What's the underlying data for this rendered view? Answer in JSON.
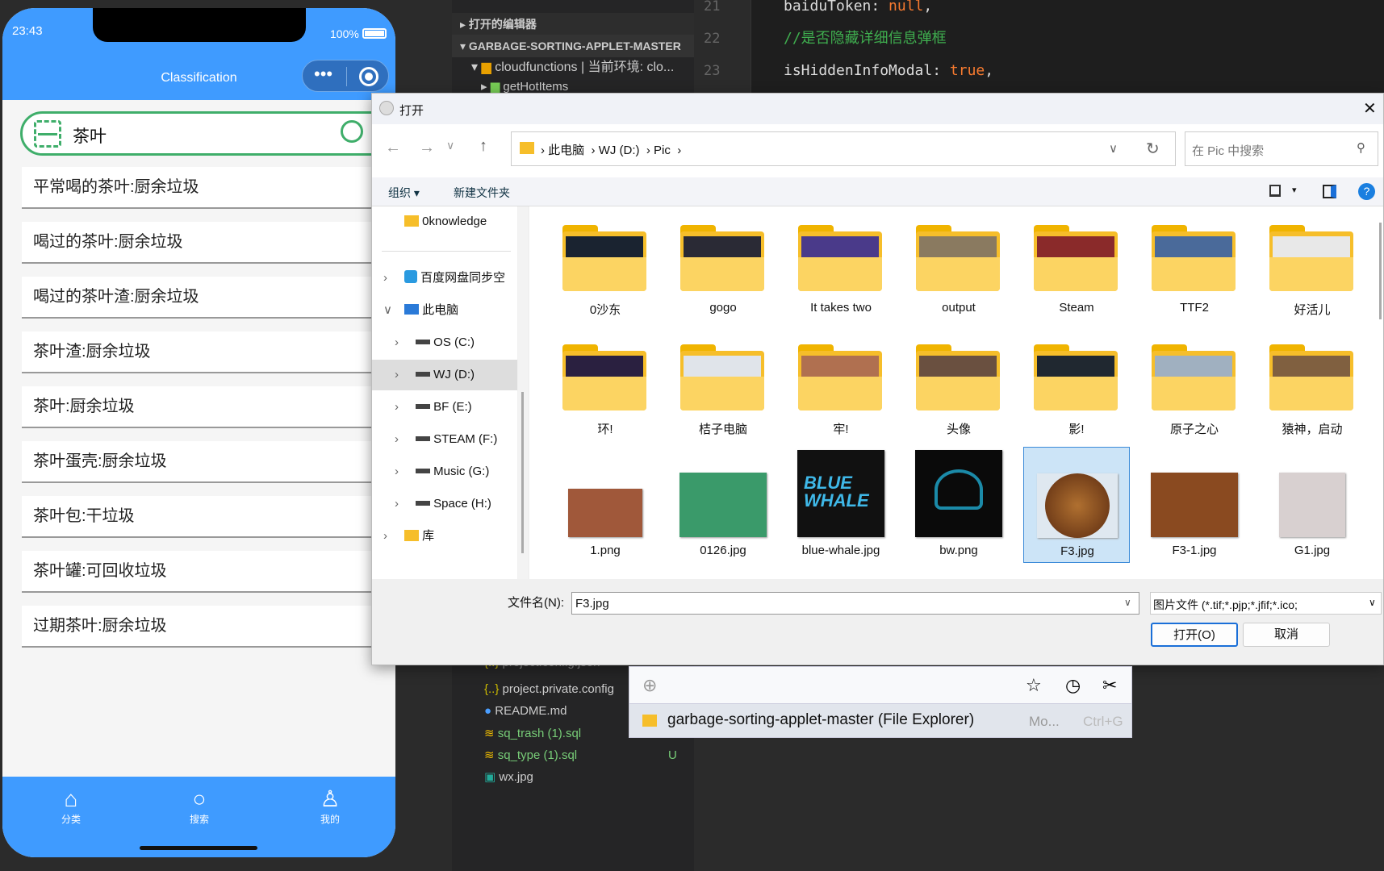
{
  "editor": {
    "sections": [
      "打开的编辑器",
      "GARBAGE-SORTING-APPLET-MASTER"
    ],
    "tree_top": [
      "cloudfunctions | 当前环境: clo...",
      "getHotItems"
    ],
    "tree_bottom": [
      "project.config.json",
      "project.private.config",
      "README.md",
      "sq_trash (1).sql",
      "sq_type (1).sql",
      "wx.jpg"
    ],
    "untracked_badge": "U",
    "line_numbers": [
      "21",
      "22",
      "23"
    ],
    "code": [
      {
        "key": "baiduToken: ",
        "val": "null",
        "end": ","
      },
      {
        "comment": "//是否隐藏详细信息弹框"
      },
      {
        "key": "isHiddenInfoModal: ",
        "val": "true",
        "end": ","
      }
    ]
  },
  "phone": {
    "time": "23:43",
    "battery": "100%",
    "title": "Classification",
    "search_value": "茶叶",
    "results": [
      "平常喝的茶叶:厨余垃圾",
      "喝过的茶叶:厨余垃圾",
      "喝过的茶叶渣:厨余垃圾",
      "茶叶渣:厨余垃圾",
      "茶叶:厨余垃圾",
      "茶叶蛋壳:厨余垃圾",
      "茶叶包:干垃圾",
      "茶叶罐:可回收垃圾",
      "过期茶叶:厨余垃圾"
    ],
    "tabs": [
      "分类",
      "搜索",
      "我的"
    ],
    "accent": "#3f9bff"
  },
  "dialog": {
    "title": "打开",
    "breadcrumb": [
      "此电脑",
      "WJ (D:)",
      "Pic"
    ],
    "search_placeholder": "在 Pic 中搜索",
    "toolbar": {
      "organize": "组织",
      "new_folder": "新建文件夹"
    },
    "sidebar": [
      {
        "label": "0knowledge",
        "icon": "folder-icon",
        "lvl": 0
      },
      {
        "label": "百度网盘同步空",
        "icon": "cloud-icon",
        "lvl": 0
      },
      {
        "label": "此电脑",
        "icon": "computer-icon",
        "lvl": 0,
        "open": true
      },
      {
        "label": "OS (C:)",
        "icon": "drive-icon",
        "lvl": 1
      },
      {
        "label": "WJ (D:)",
        "icon": "drive-icon",
        "lvl": 1,
        "selected": true
      },
      {
        "label": "BF (E:)",
        "icon": "drive-icon",
        "lvl": 1
      },
      {
        "label": "STEAM (F:)",
        "icon": "drive-icon",
        "lvl": 1
      },
      {
        "label": "Music (G:)",
        "icon": "drive-icon",
        "lvl": 1
      },
      {
        "label": "Space (H:)",
        "icon": "drive-icon",
        "lvl": 1
      },
      {
        "label": "库",
        "icon": "folder-icon",
        "lvl": 0
      }
    ],
    "items": [
      {
        "name": "0沙东",
        "type": "folder",
        "c": "#1a2330"
      },
      {
        "name": "gogo",
        "type": "folder",
        "c": "#2a2a35"
      },
      {
        "name": "It takes two",
        "type": "folder",
        "c": "#4a3a8a"
      },
      {
        "name": "output",
        "type": "folder",
        "c": "#8a7a60"
      },
      {
        "name": "Steam",
        "type": "folder",
        "c": "#8a2a2a"
      },
      {
        "name": "TTF2",
        "type": "folder",
        "c": "#4a6a9a"
      },
      {
        "name": "好活儿",
        "type": "folder",
        "c": "#e8e8e8"
      },
      {
        "name": "环!",
        "type": "folder",
        "c": "#2a2040"
      },
      {
        "name": "桔子电脑",
        "type": "folder",
        "c": "#e0e4ea"
      },
      {
        "name": "牢!",
        "type": "folder",
        "c": "#b07050"
      },
      {
        "name": "头像",
        "type": "folder",
        "c": "#6a5040"
      },
      {
        "name": "影!",
        "type": "folder",
        "c": "#202830"
      },
      {
        "name": "原子之心",
        "type": "folder",
        "c": "#a0b0c0"
      },
      {
        "name": "猿神，启动",
        "type": "folder",
        "c": "#806040"
      },
      {
        "name": "1.png",
        "type": "image",
        "c": "#a0583a"
      },
      {
        "name": "0126.jpg",
        "type": "image",
        "c": "#3a9a6a"
      },
      {
        "name": "blue-whale.jpg",
        "type": "image",
        "c": "#111111"
      },
      {
        "name": "bw.png",
        "type": "image",
        "c": "#0a0a0a"
      },
      {
        "name": "F3.jpg",
        "type": "image",
        "c": "#7a4a20",
        "selected": true
      },
      {
        "name": "F3-1.jpg",
        "type": "image",
        "c": "#8a4a20"
      },
      {
        "name": "G1.jpg",
        "type": "image",
        "c": "#d8d0d0"
      }
    ],
    "whale_text": "BLUE WHALE",
    "filename_label": "文件名(N):",
    "filename_value": "F3.jpg",
    "filetype": "图片文件 (*.tif;*.pjp;*.jfif;*.ico;",
    "open_button": "打开(O)",
    "cancel_button": "取消"
  },
  "launcher": {
    "result": "garbage-sorting-applet-master (File Explorer)",
    "hint": "Mo...",
    "shortcut": "Ctrl+G"
  }
}
